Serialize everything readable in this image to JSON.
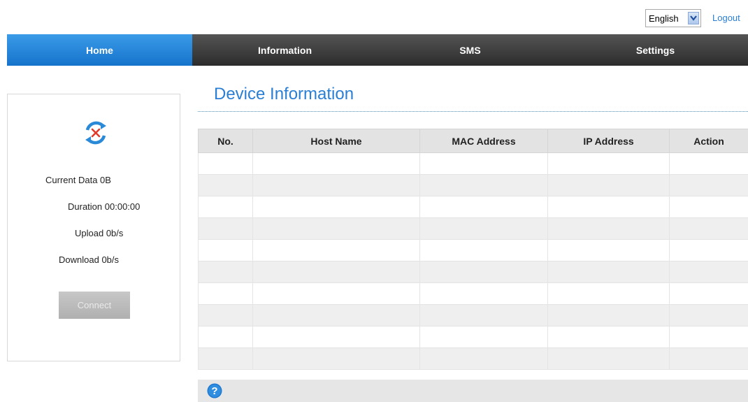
{
  "header": {
    "language": "English",
    "logout_label": "Logout"
  },
  "nav": {
    "items": [
      {
        "label": "Home",
        "active": true
      },
      {
        "label": "Information",
        "active": false
      },
      {
        "label": "SMS",
        "active": false
      },
      {
        "label": "Settings",
        "active": false
      }
    ]
  },
  "status_panel": {
    "icon": "disconnected-sync-icon",
    "current_data_label": "Current Data",
    "current_data_value": "0B",
    "duration_label": "Duration",
    "duration_value": "00:00:00",
    "upload_label": "Upload",
    "upload_value": "0b/s",
    "download_label": "Download",
    "download_value": "0b/s",
    "connect_label": "Connect"
  },
  "main": {
    "title": "Device Information",
    "table": {
      "columns": [
        "No.",
        "Host Name",
        "MAC Address",
        "IP Address",
        "Action"
      ],
      "rows": [
        [
          "",
          "",
          "",
          "",
          ""
        ],
        [
          "",
          "",
          "",
          "",
          ""
        ],
        [
          "",
          "",
          "",
          "",
          ""
        ],
        [
          "",
          "",
          "",
          "",
          ""
        ],
        [
          "",
          "",
          "",
          "",
          ""
        ],
        [
          "",
          "",
          "",
          "",
          ""
        ],
        [
          "",
          "",
          "",
          "",
          ""
        ],
        [
          "",
          "",
          "",
          "",
          ""
        ],
        [
          "",
          "",
          "",
          "",
          ""
        ],
        [
          "",
          "",
          "",
          "",
          ""
        ]
      ]
    }
  },
  "footer": {
    "icon": "help-icon"
  },
  "colors": {
    "accent": "#2a7fd4",
    "nav_active": "#1f86d9",
    "nav_bg": "#3a3a3a",
    "disconnect_x": "#e23a2b"
  }
}
